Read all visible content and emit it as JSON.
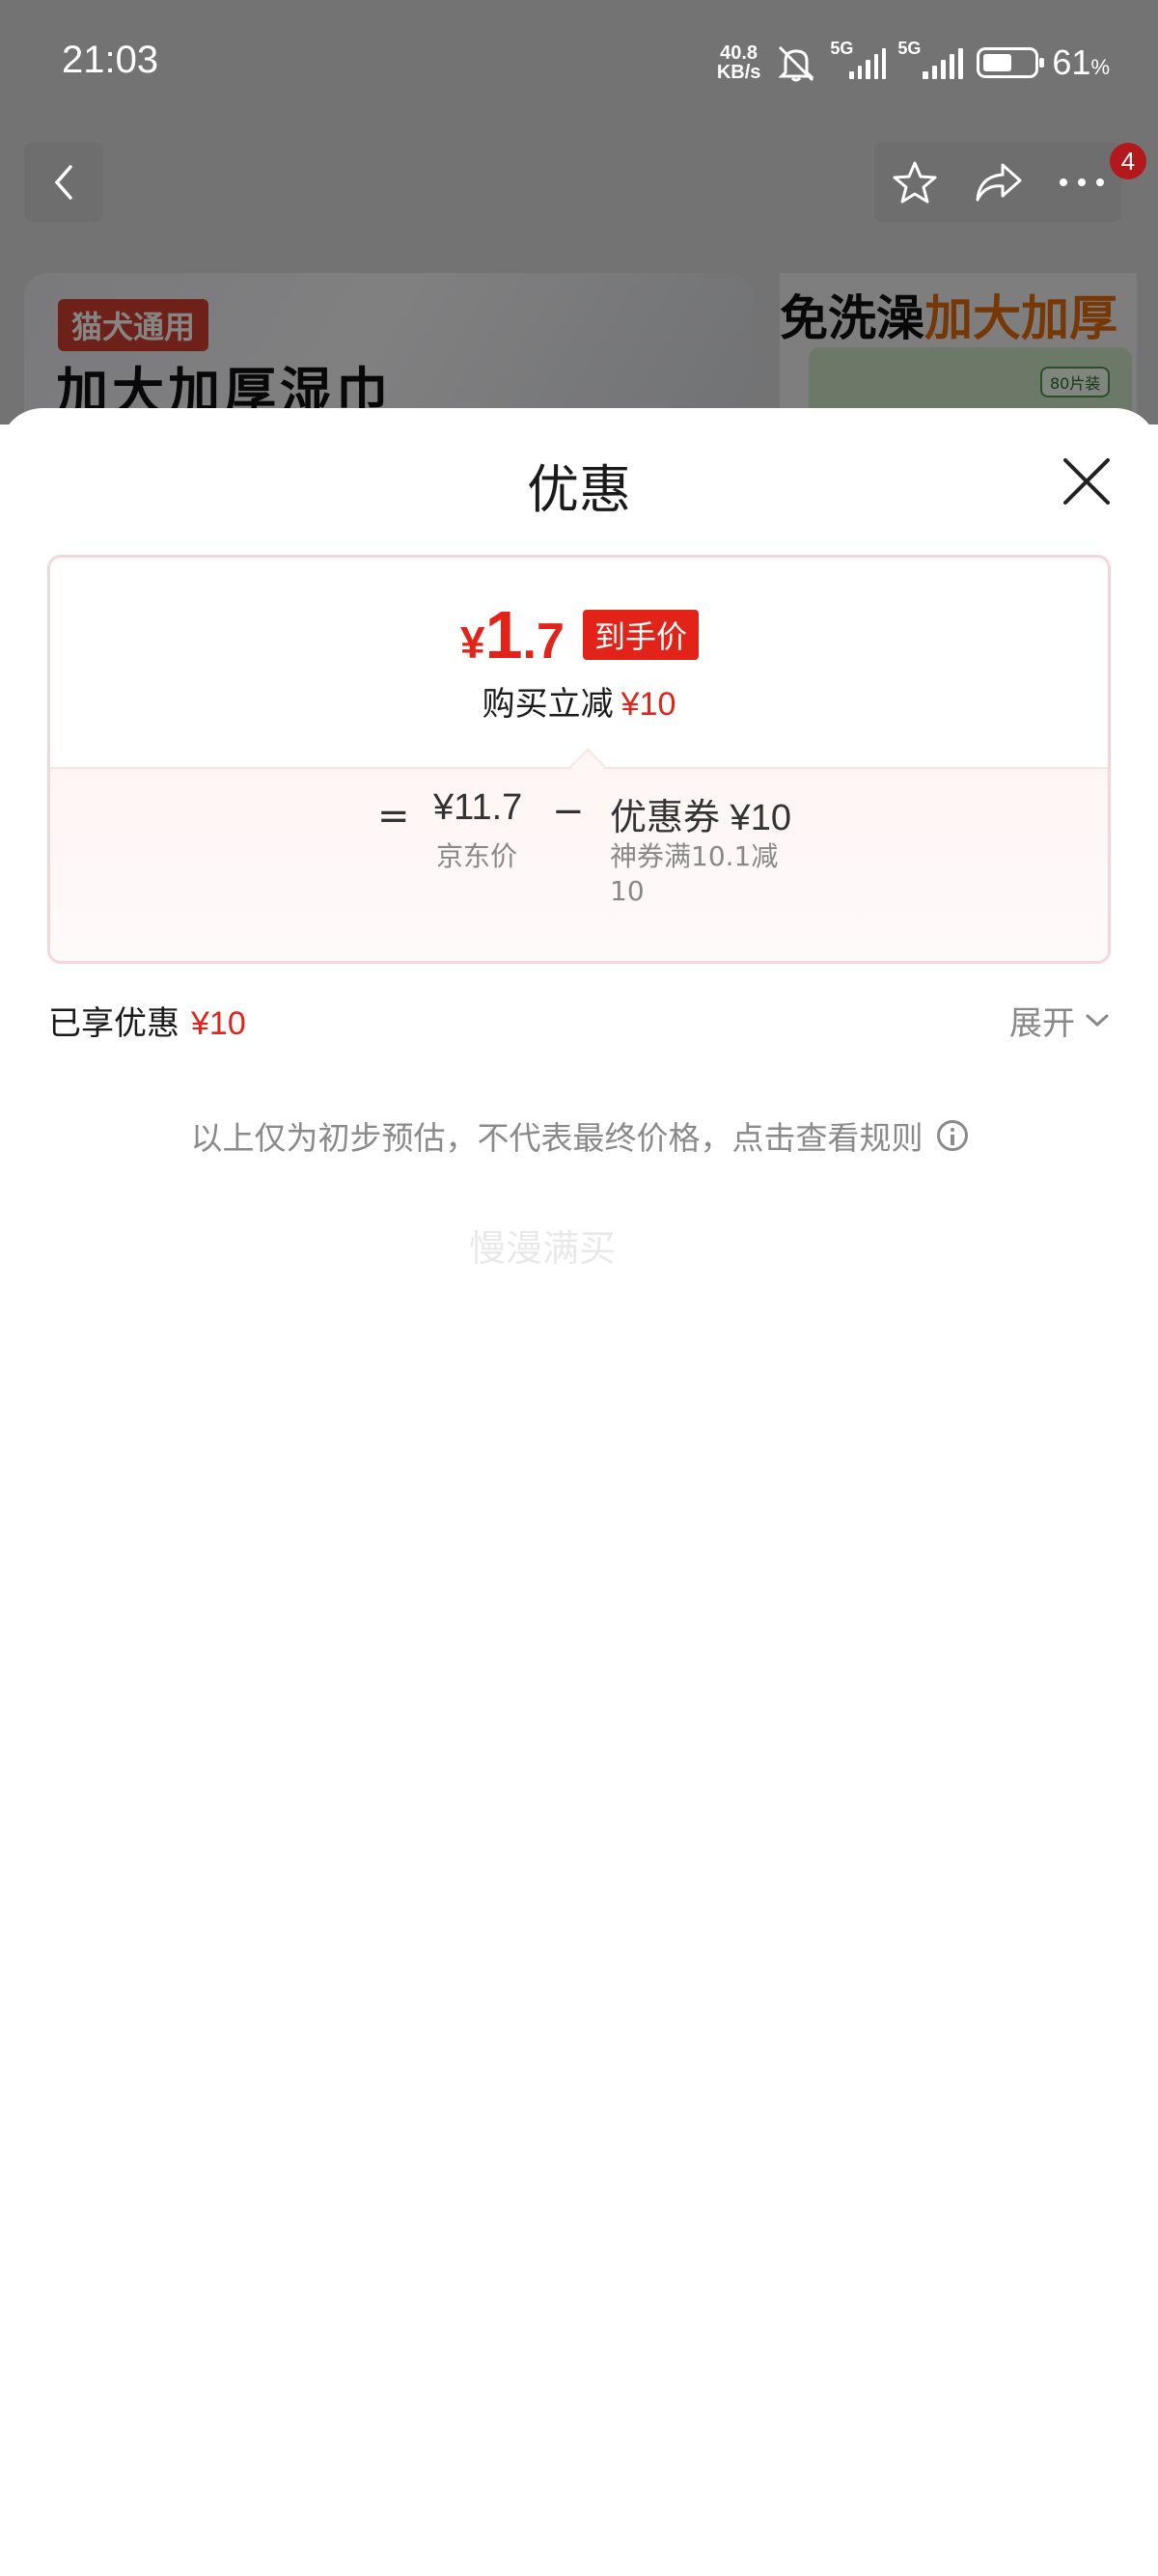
{
  "status_bar": {
    "time": "21:03",
    "net_speed_value": "40.8",
    "net_speed_unit": "KB/s",
    "sim1_label": "5G",
    "sim2_label": "5G",
    "battery_percent": "61",
    "battery_unit": "%",
    "battery_level": 0.61
  },
  "background_page": {
    "cart_badge": "4",
    "banner_tag": "猫犬通用",
    "banner_title": "加大加厚湿巾",
    "banner_right_title_a": "免洗澡",
    "banner_right_title_b": "加大加厚",
    "package_label": "80片装"
  },
  "sheet": {
    "title": "优惠",
    "final_price": {
      "currency": "¥",
      "integer": "1",
      "decimal": ".7",
      "tag": "到手价"
    },
    "reduce": {
      "label": "购买立减",
      "amount": "¥10"
    },
    "breakdown": {
      "equals": "=",
      "jd_price": "¥11.7",
      "jd_price_label": "京东价",
      "minus": "−",
      "coupon": "优惠券 ¥10",
      "coupon_desc_line1": "神券满10.1减",
      "coupon_desc_line2": "10"
    },
    "enjoyed": {
      "label": "已享优惠",
      "amount": "¥10"
    },
    "expand_label": "展开",
    "disclaimer": "以上仅为初步预估，不代表最终价格，点击查看规则",
    "watermark": "慢漫满买"
  },
  "colors": {
    "accent_red": "#e2231a",
    "card_border": "#f7d4da",
    "muted_text": "#8a8a8a"
  }
}
